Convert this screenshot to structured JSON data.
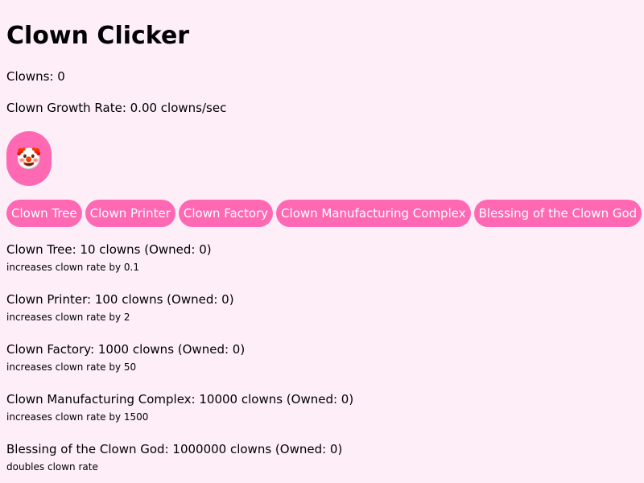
{
  "app": {
    "title": "Clown Clicker"
  },
  "stats": {
    "clowns_text": "Clowns: 0",
    "rate_text": "Clown Growth Rate: 0.00 clowns/sec"
  },
  "clicker": {
    "emoji": "🤡"
  },
  "buttons": [
    {
      "label": "Clown Tree"
    },
    {
      "label": "Clown Printer"
    },
    {
      "label": "Clown Factory"
    },
    {
      "label": "Clown Manufacturing Complex"
    },
    {
      "label": "Blessing of the Clown God"
    }
  ],
  "items": [
    {
      "title": "Clown Tree: 10 clowns (Owned: 0)",
      "desc": "increases clown rate by 0.1"
    },
    {
      "title": "Clown Printer: 100 clowns (Owned: 0)",
      "desc": "increases clown rate by 2"
    },
    {
      "title": "Clown Factory: 1000 clowns (Owned: 0)",
      "desc": "increases clown rate by 50"
    },
    {
      "title": "Clown Manufacturing Complex: 10000 clowns (Owned: 0)",
      "desc": "increases clown rate by 1500"
    },
    {
      "title": "Blessing of the Clown God: 1000000 clowns (Owned: 0)",
      "desc": "doubles clown rate"
    }
  ],
  "colors": {
    "background": "#fdeef8",
    "accent": "#ff69b4",
    "button_text": "#ffffff"
  }
}
